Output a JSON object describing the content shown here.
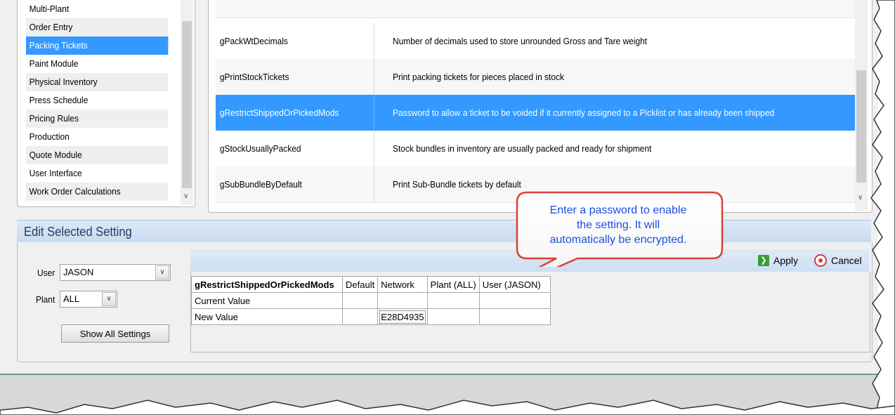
{
  "categories": {
    "items": [
      {
        "label": "Multi-Plant",
        "selected": false
      },
      {
        "label": "Order Entry",
        "selected": false
      },
      {
        "label": "Packing Tickets",
        "selected": true
      },
      {
        "label": "Paint Module",
        "selected": false
      },
      {
        "label": "Physical Inventory",
        "selected": false
      },
      {
        "label": "Press Schedule",
        "selected": false
      },
      {
        "label": "Pricing Rules",
        "selected": false
      },
      {
        "label": "Production",
        "selected": false
      },
      {
        "label": "Quote Module",
        "selected": false
      },
      {
        "label": "User Interface",
        "selected": false
      },
      {
        "label": "Work Order Calculations",
        "selected": false
      }
    ]
  },
  "settings": {
    "rows": [
      {
        "name": "gPackWtDecimals",
        "description": "Number of decimals used to store unrounded Gross and Tare weight",
        "selected": false
      },
      {
        "name": "gPrintStockTickets",
        "description": "Print packing tickets for pieces placed in stock",
        "selected": false
      },
      {
        "name": "gRestrictShippedOrPickedMods",
        "description": "Password to allow a ticket to be voided if it currently assigned to a Picklist or has already been shipped",
        "selected": true
      },
      {
        "name": "gStockUsuallyPacked",
        "description": "Stock bundles in inventory are usually packed and ready for shipment",
        "selected": false
      },
      {
        "name": "gSubBundleByDefault",
        "description": "Print Sub-Bundle tickets by default",
        "selected": false
      }
    ]
  },
  "edit": {
    "title": "Edit Selected Setting",
    "user_label": "User",
    "user_value": "JASON",
    "plant_label": "Plant",
    "plant_value": "ALL",
    "show_all_label": "Show All Settings",
    "apply_label": "Apply",
    "cancel_label": "Cancel",
    "grid": {
      "columns": [
        "gRestrictShippedOrPickedMods",
        "Default",
        "Network",
        "Plant (ALL)",
        "User (JASON)"
      ],
      "rows": [
        {
          "label": "Current Value",
          "values": [
            "",
            "",
            "",
            ""
          ]
        },
        {
          "label": "New Value",
          "values": [
            "",
            "E28D4935",
            "",
            ""
          ]
        }
      ]
    }
  },
  "callout": {
    "lines": [
      "Enter a password to enable",
      "the setting. It will",
      "automatically be encrypted."
    ],
    "color": "#d9403a",
    "text_color": "#1c4fe0"
  },
  "colors": {
    "selection": "#3399ff",
    "header": "#c8dbf0"
  },
  "icons": [
    "apply-icon",
    "cancel-icon",
    "chevron-down-icon"
  ]
}
